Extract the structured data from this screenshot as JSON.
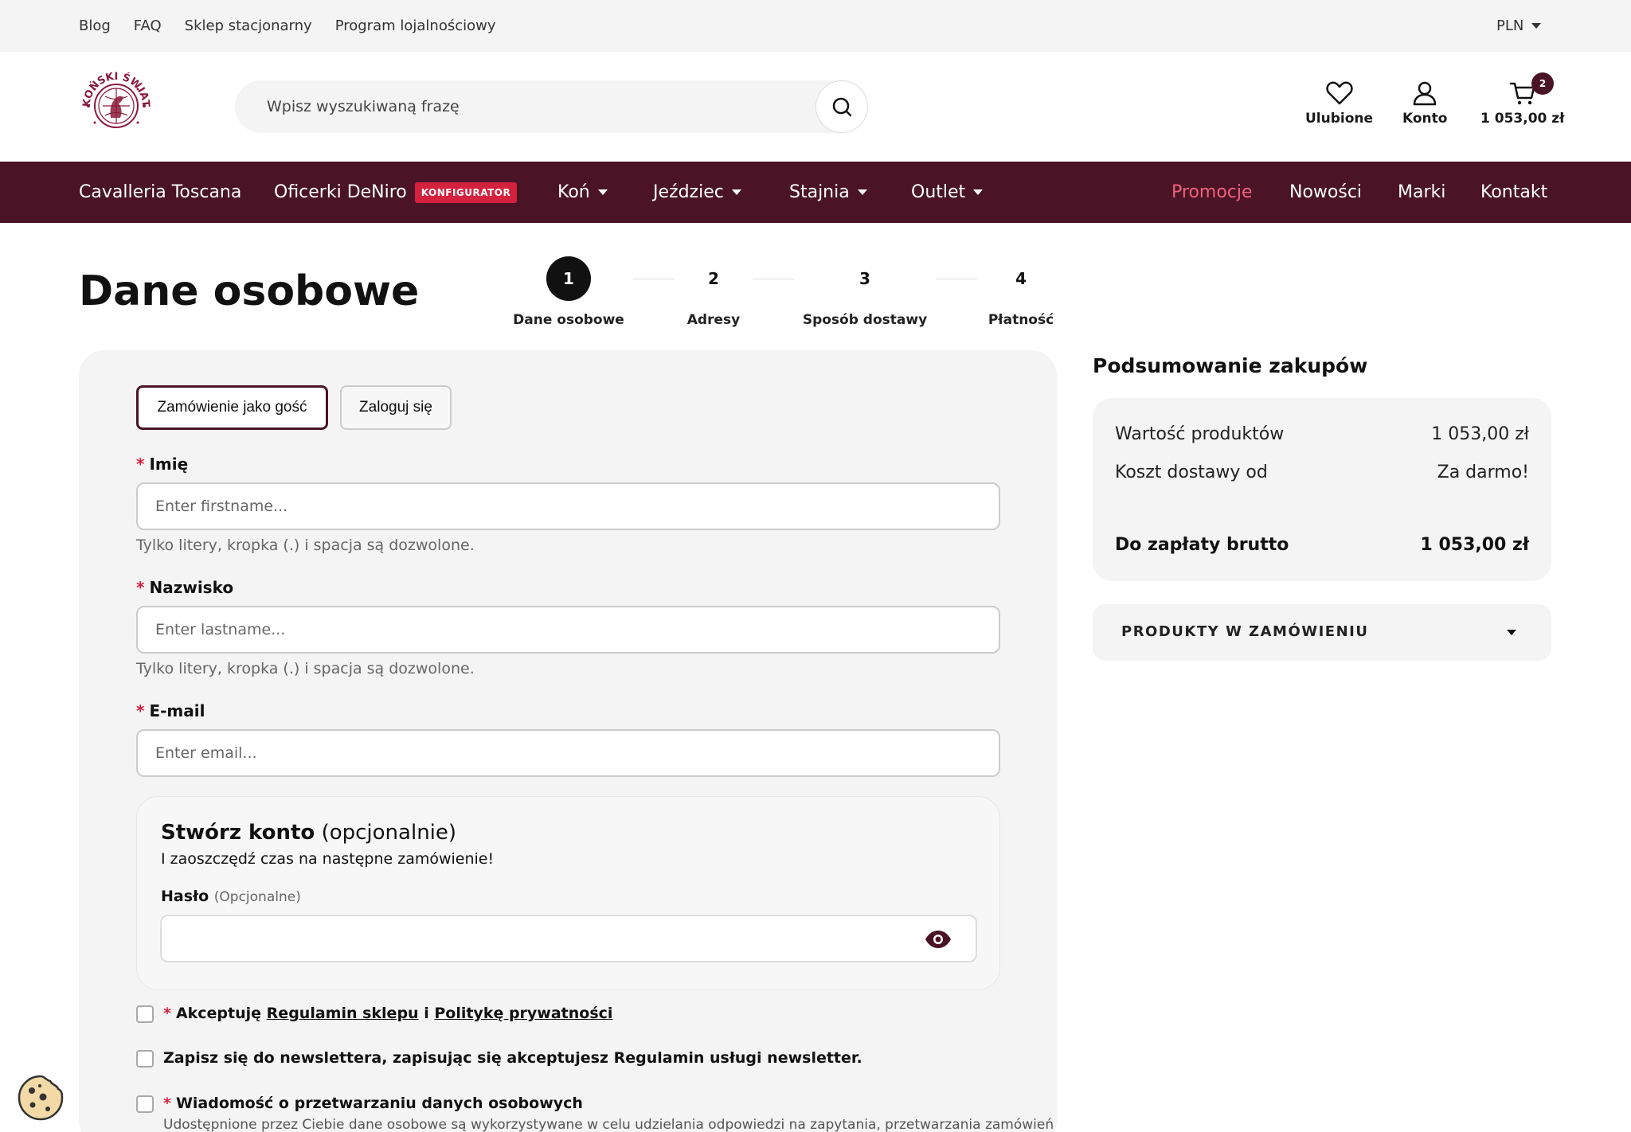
{
  "topbar": {
    "links": [
      "Blog",
      "FAQ",
      "Sklep stacjonarny",
      "Program lojalnościowy"
    ],
    "currency": "PLN"
  },
  "header": {
    "logo_text": "KOŃSKI ŚWIAT",
    "search_placeholder": "Wpisz wyszukiwaną frazę",
    "favorites_label": "Ulubione",
    "account_label": "Konto",
    "cart_total": "1 053,00 zł",
    "cart_count": "2"
  },
  "nav": {
    "cavalleria": "Cavalleria Toscana",
    "oficerki": "Oficerki DeNiro",
    "konfigurator_badge": "KONFIGURATOR",
    "kon": "Koń",
    "jezdziec": "Jeździec",
    "stajnia": "Stajnia",
    "outlet": "Outlet",
    "promocje": "Promocje",
    "nowosci": "Nowości",
    "marki": "Marki",
    "kontakt": "Kontakt"
  },
  "page": {
    "title": "Dane osobowe"
  },
  "steps": [
    {
      "num": "1",
      "label": "Dane osobowe"
    },
    {
      "num": "2",
      "label": "Adresy"
    },
    {
      "num": "3",
      "label": "Sposób dostawy"
    },
    {
      "num": "4",
      "label": "Płatność"
    }
  ],
  "form": {
    "guest_tab": "Zamówienie jako gość",
    "login_tab": "Zaloguj się",
    "required_mark": "*",
    "firstname_label": "Imię",
    "firstname_placeholder": "Enter firstname...",
    "firstname_hint": "Tylko litery, kropka (.) i spacja są dozwolone.",
    "lastname_label": "Nazwisko",
    "lastname_placeholder": "Enter lastname...",
    "lastname_hint": "Tylko litery, kropka (.) i spacja są dozwolone.",
    "email_label": "E-mail",
    "email_placeholder": "Enter email...",
    "create_title": "Stwórz konto",
    "create_optional": "(opcjonalnie)",
    "create_sub": "I zaoszczędź czas na następne zamówienie!",
    "password_label": "Hasło",
    "password_optional": "(Opcjonalne)",
    "terms_prefix": "Akceptuję",
    "terms_link": "Regulamin sklepu",
    "terms_and": "i",
    "privacy_link": "Politykę prywatności",
    "newsletter": "Zapisz się do newslettera, zapisując się akceptujesz Regulamin usługi newsletter.",
    "data_processing": "Wiadomość o przetwarzaniu danych osobowych",
    "data_processing_desc": "Udostępnione przez Ciebie dane osobowe są wykorzystywane w celu udzielania odpowiedzi na zapytania, przetwarzania zamówień"
  },
  "summary": {
    "title": "Podsumowanie zakupów",
    "products_value_label": "Wartość produktów",
    "products_value": "1 053,00 zł",
    "shipping_label": "Koszt dostawy od",
    "shipping_value": "Za darmo!",
    "total_label": "Do zapłaty brutto",
    "total_value": "1 053,00 zł",
    "products_toggle": "PRODUKTY W ZAMÓWIENIU"
  },
  "colors": {
    "brand": "#4a1426",
    "promo": "#f0607c",
    "badge_red": "#d4213d",
    "panel": "#f4f4f4"
  }
}
